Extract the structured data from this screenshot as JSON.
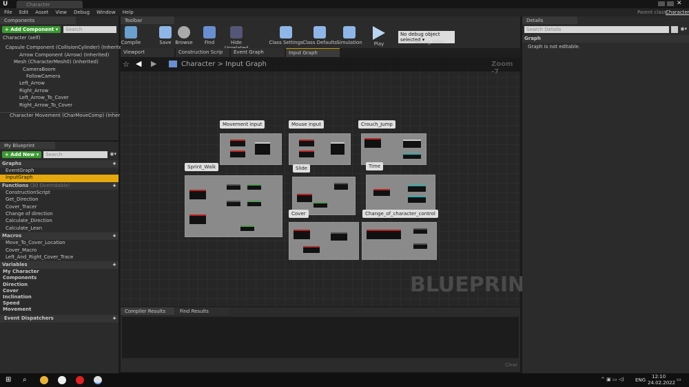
{
  "window": {
    "tab_title": "Character",
    "parent_class_label": "Parent class:",
    "parent_class": "Character"
  },
  "menu": [
    "File",
    "Edit",
    "Asset",
    "View",
    "Debug",
    "Window",
    "Help"
  ],
  "components": {
    "tab": "Components",
    "add_button": "+ Add Component ▾",
    "search_placeholder": "Search",
    "self": "Character (self)",
    "tree": [
      "Capsule Component (CollisionCylinder) (Inherited)",
      "Arrow Component (Arrow) (Inherited)",
      "Mesh (CharacterMesh0) (Inherited)",
      "CameraBoom",
      "FollowCamera",
      "Left_Arrow",
      "Right_Arrow",
      "Left_Arrow_To_Cover",
      "Right_Arrow_To_Cover"
    ],
    "movement": "Character Movement (CharMoveComp) (Inherited)"
  },
  "my_blueprint": {
    "tab": "My Blueprint",
    "add_button": "+ Add New ▾",
    "search_placeholder": "Search",
    "graphs_label": "Graphs",
    "graphs": [
      "EventGraph",
      "InputGraph"
    ],
    "functions_label": "Functions",
    "functions_count": "(30 Overridable)",
    "functions": [
      "ConstructionScript",
      "Get_Direction",
      "Cover_Tracer",
      "Change of direction",
      "Calculate_Direction",
      "Calculate_Lean"
    ],
    "macros_label": "Macros",
    "macros": [
      "Move_To_Cover_Location",
      "Cover_Macro",
      "Left_And_Right_Cover_Trace"
    ],
    "variables_label": "Variables",
    "variables": [
      "My Character",
      "Components",
      "Direction",
      "Cover",
      "Inclination",
      "Speed",
      "Movement"
    ],
    "dispatchers_label": "Event Dispatchers"
  },
  "toolbar": {
    "tab": "Toolbar",
    "buttons": [
      "Compile",
      "Save",
      "Browse",
      "Find",
      "Hide Unrelated",
      "Class Settings",
      "Class Defaults",
      "Simulation",
      "Play"
    ],
    "debug_select": "No debug object selected ▾",
    "debug_label": "Debug Filter"
  },
  "doc_tabs": [
    "Viewport",
    "Construction Scrip",
    "Event Graph",
    "Input Graph"
  ],
  "graph": {
    "breadcrumb_root": "Character",
    "breadcrumb_sep": ">",
    "breadcrumb_current": "Input Graph",
    "zoom": "Zoom -7",
    "watermark": "BLUEPRINT",
    "comments": [
      "Movement input",
      "Mouse input",
      "Crouch_Jump",
      "Sprint_Walk",
      "Slide",
      "Time",
      "Cover",
      "Change_of_character_control"
    ]
  },
  "bottom": {
    "tabs": [
      "Compiler Results",
      "Find Results"
    ],
    "clear": "Clear"
  },
  "details": {
    "tab": "Details",
    "search_placeholder": "Search Details",
    "section": "Graph",
    "message": "Graph is not editable."
  },
  "taskbar": {
    "lang": "ENG",
    "time": "12:10",
    "date": "24.02.2022"
  }
}
